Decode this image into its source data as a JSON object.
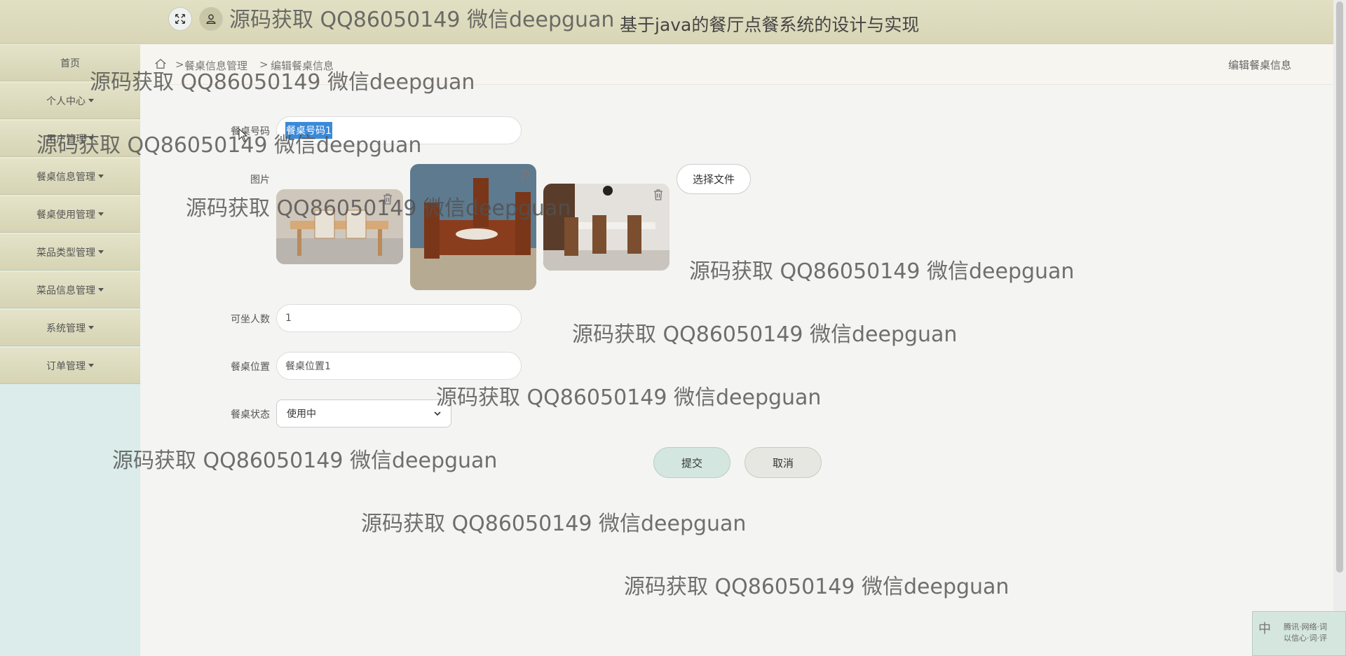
{
  "header": {
    "site_title": "基于java的餐厅点餐系统的设计与实现",
    "fullscreen_icon": "expand-icon",
    "user_icon": "user-icon"
  },
  "sidebar": {
    "items": [
      {
        "label": "首页",
        "has_dropdown": false
      },
      {
        "label": "个人中心",
        "has_dropdown": true
      },
      {
        "label": "用户管理",
        "has_dropdown": true
      },
      {
        "label": "餐桌信息管理",
        "has_dropdown": true
      },
      {
        "label": "餐桌使用管理",
        "has_dropdown": true
      },
      {
        "label": "菜品类型管理",
        "has_dropdown": true
      },
      {
        "label": "菜品信息管理",
        "has_dropdown": true
      },
      {
        "label": "系统管理",
        "has_dropdown": true
      },
      {
        "label": "订单管理",
        "has_dropdown": true
      }
    ]
  },
  "breadcrumb": {
    "home_icon": "home-icon",
    "sep": ">",
    "level1": "餐桌信息管理",
    "level2": "编辑餐桌信息",
    "page_title": "编辑餐桌信息"
  },
  "form": {
    "table_no_label": "餐桌号码",
    "table_no_value": "餐桌号码1",
    "image_label": "图片",
    "choose_file_label": "选择文件",
    "seats_label": "可坐人数",
    "seats_value": "1",
    "location_label": "餐桌位置",
    "location_value": "餐桌位置1",
    "status_label": "餐桌状态",
    "status_value": "使用中",
    "submit_label": "提交",
    "cancel_label": "取消"
  },
  "watermark_text": "源码获取 QQ86050149 微信deepguan",
  "ime": {
    "mode": "中",
    "line1": "腾讯·网络·词",
    "line2": "以信心·词·评"
  },
  "colors": {
    "header_bg": "#dcdabb",
    "sidebar_item_bg": "#dedcc0",
    "sidebar_bg": "#dbecea",
    "submit_bg": "#d3e6df",
    "selection": "#3b8ad9"
  }
}
